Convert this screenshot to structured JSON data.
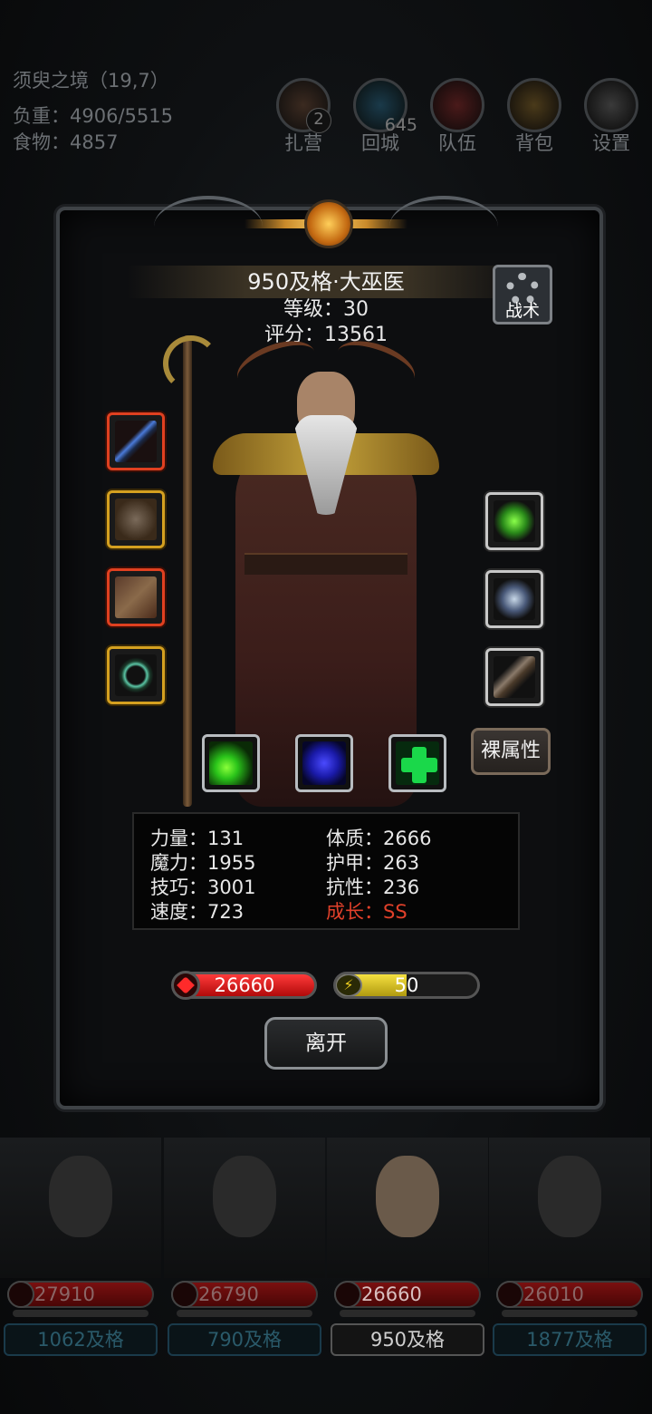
{
  "hud": {
    "location": "须臾之境（19,7）",
    "weight": "负重：4906/5515",
    "food": "食物：4857",
    "buttons": [
      {
        "label": "扎营",
        "badge": "2",
        "icon": "camp-icon"
      },
      {
        "label": "回城",
        "badge": "645",
        "icon": "portal-icon"
      },
      {
        "label": "队伍",
        "badge": "",
        "icon": "team-icon"
      },
      {
        "label": "背包",
        "badge": "",
        "icon": "backpack-icon"
      },
      {
        "label": "设置",
        "badge": "",
        "icon": "gear-icon"
      }
    ]
  },
  "hero": {
    "title": "950及格·大巫医",
    "level": "等级：30",
    "score": "评分：13561",
    "tactic_label": "战术",
    "bare_attr_label": "裸属性",
    "equipment_left": [
      {
        "name": "staff-weapon",
        "rarity": "red"
      },
      {
        "name": "armor",
        "rarity": "gold"
      },
      {
        "name": "spellbook",
        "rarity": "red"
      },
      {
        "name": "ring",
        "rarity": "gold"
      }
    ],
    "equipment_right": [
      {
        "name": "green-crystal",
        "rarity": "grey"
      },
      {
        "name": "amulet",
        "rarity": "grey"
      },
      {
        "name": "bracer",
        "rarity": "grey"
      }
    ],
    "skills": [
      {
        "name": "green-bolt-skill",
        "color": "#2ac41a"
      },
      {
        "name": "shadow-skill",
        "color": "#2a2ad8"
      },
      {
        "name": "heal-cross-skill",
        "color": "#1ad84a"
      }
    ],
    "stats": {
      "strength": "力量：131",
      "magic": "魔力：1955",
      "skill": "技巧：3001",
      "speed": "速度：723",
      "constitution": "体质：2666",
      "armor": "护甲：263",
      "resistance": "抗性：236",
      "growth": "成长：SS"
    },
    "hp": "26660",
    "mp": "50",
    "mp_fraction": 0.5,
    "leave_label": "离开",
    "colors": {
      "growth": "#e0402a",
      "hp": "#d81a1a",
      "mp": "#e0c820"
    }
  },
  "team": [
    {
      "hp": "27910",
      "label": "1062及格",
      "active": false
    },
    {
      "hp": "26790",
      "label": "790及格",
      "active": false
    },
    {
      "hp": "26660",
      "label": "950及格",
      "active": true
    },
    {
      "hp": "26010",
      "label": "1877及格",
      "active": false
    }
  ]
}
